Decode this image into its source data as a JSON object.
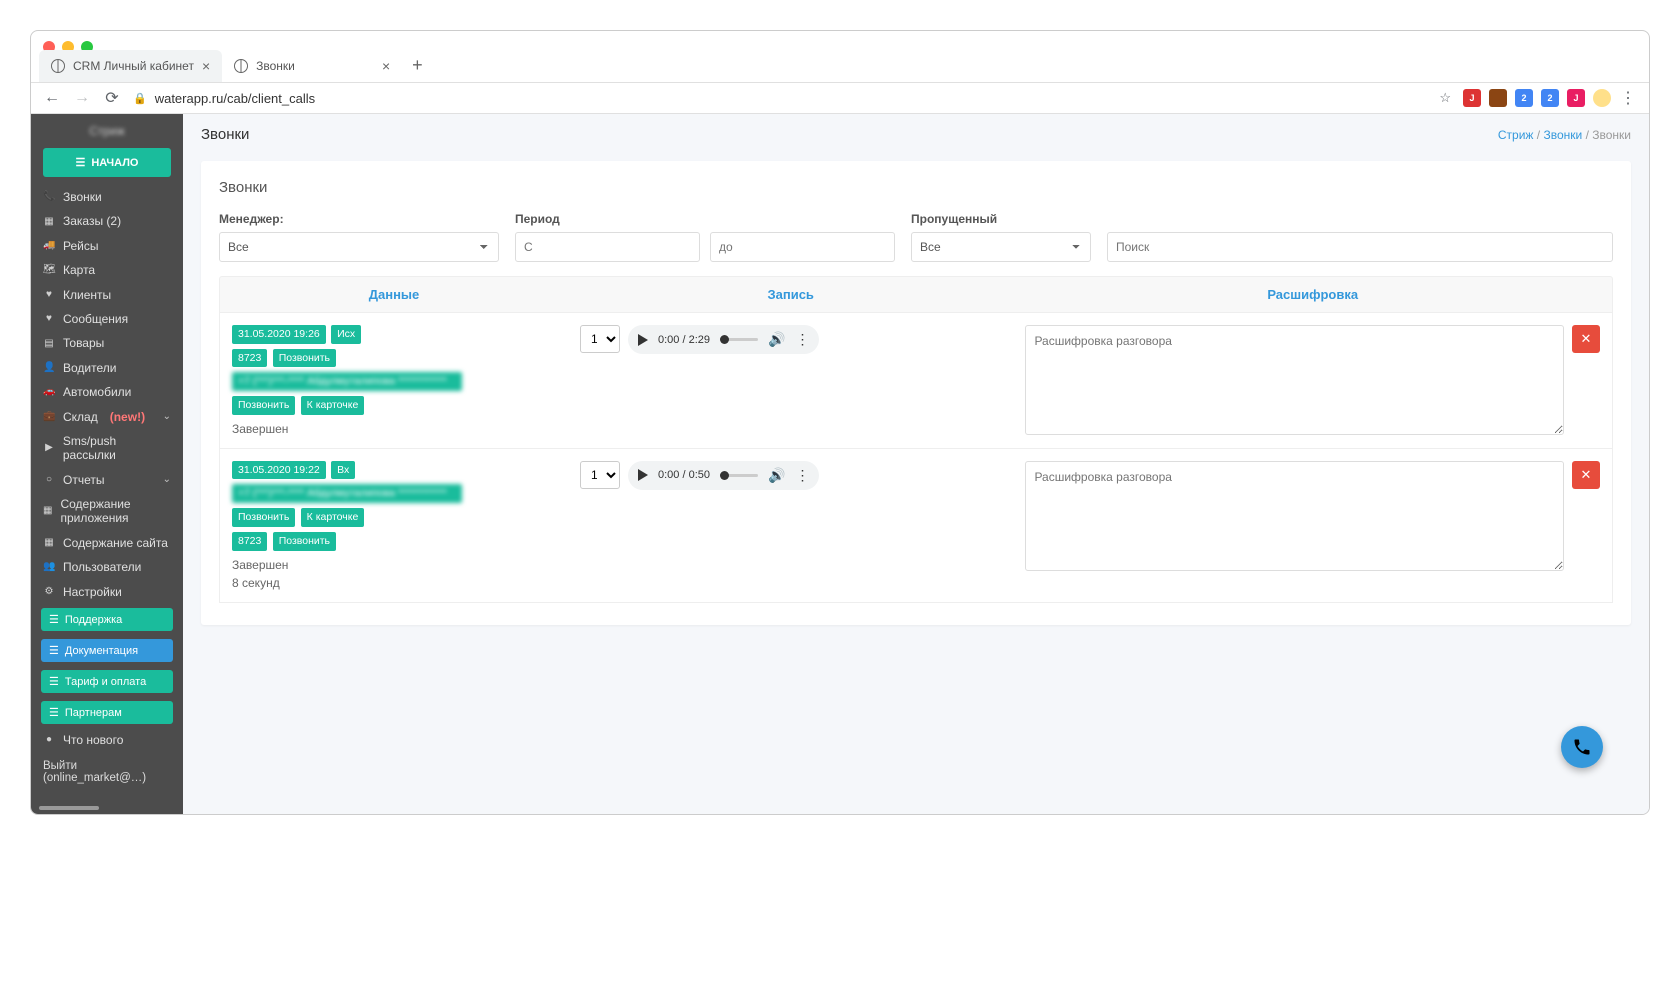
{
  "browser": {
    "tabs": [
      {
        "title": "CRM Личный кабинет",
        "active": false
      },
      {
        "title": "Звонки",
        "active": true
      }
    ],
    "url": "waterapp.ru/cab/client_calls"
  },
  "sidebar": {
    "brand": "Стриж",
    "start_button": "НАЧАЛО",
    "items": [
      {
        "icon": "📞",
        "label": "Звонки"
      },
      {
        "icon": "▦",
        "label": "Заказы (2)"
      },
      {
        "icon": "🚚",
        "label": "Рейсы"
      },
      {
        "icon": "🗺",
        "label": "Карта"
      },
      {
        "icon": "♥",
        "label": "Клиенты"
      },
      {
        "icon": "♥",
        "label": "Сообщения"
      },
      {
        "icon": "▤",
        "label": "Товары"
      },
      {
        "icon": "👤",
        "label": "Водители"
      },
      {
        "icon": "🚗",
        "label": "Автомобили"
      },
      {
        "icon": "💼",
        "label": "Склад",
        "new": "(new!)",
        "chevron": true
      },
      {
        "icon": "▶",
        "label": "Sms/push рассылки"
      },
      {
        "icon": "○",
        "label": "Отчеты",
        "chevron": true
      },
      {
        "icon": "▦",
        "label": "Содержание приложения"
      },
      {
        "icon": "▦",
        "label": "Содержание сайта"
      },
      {
        "icon": "👥",
        "label": "Пользователи"
      },
      {
        "icon": "⚙",
        "label": "Настройки"
      }
    ],
    "buttons": [
      {
        "label": "Поддержка",
        "color": "teal"
      },
      {
        "label": "Документация",
        "color": "blue"
      },
      {
        "label": "Тариф и оплата",
        "color": "teal"
      },
      {
        "label": "Партнерам",
        "color": "teal"
      }
    ],
    "whats_new": {
      "icon": "●",
      "label": "Что нового"
    },
    "logout": "Выйти (online_market@…)"
  },
  "page": {
    "title": "Звонки",
    "breadcrumb": {
      "root": "Стриж",
      "section": "Звонки",
      "current": "Звонки"
    }
  },
  "panel": {
    "title": "Звонки",
    "filters": {
      "manager_label": "Менеджер:",
      "manager_value": "Все",
      "period_label": "Период",
      "from_placeholder": "С",
      "to_placeholder": "до",
      "missed_label": "Пропущенный",
      "missed_value": "Все",
      "search_placeholder": "Поиск"
    },
    "columns": {
      "data": "Данные",
      "record": "Запись",
      "transcript": "Расшифровка"
    },
    "rows": [
      {
        "datetime": "31.05.2020 19:26",
        "direction": "Исх",
        "ext": "8723",
        "call_btn": "Позвонить",
        "phone": "+7 (***)***-**** Абдулмуталипова ************",
        "call_btn2": "Позвонить",
        "card_btn": "К карточке",
        "status": "Завершен",
        "extra": "",
        "speed": "1",
        "time_current": "0:00",
        "time_total": "2:29",
        "transcript_placeholder": "Расшифровка разговора"
      },
      {
        "datetime": "31.05.2020 19:22",
        "direction": "Вх",
        "phone": "+7 (***)***-**** Абдулмуталипова ************",
        "call_btn": "Позвонить",
        "card_btn": "К карточке",
        "ext": "8723",
        "call_btn2": "Позвонить",
        "status": "Завершен",
        "extra": "8 секунд",
        "speed": "1",
        "time_current": "0:00",
        "time_total": "0:50",
        "transcript_placeholder": "Расшифровка разговора"
      }
    ]
  }
}
